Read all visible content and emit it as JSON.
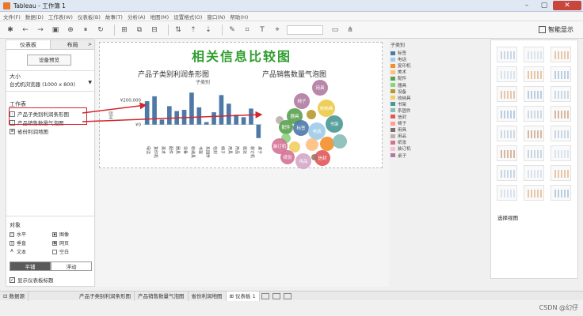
{
  "window": {
    "title": "Tableau - 工作簿 1"
  },
  "menu": [
    "文件(F)",
    "数据(D)",
    "工作表(W)",
    "仪表板(B)",
    "故事(T)",
    "分析(A)",
    "地图(M)",
    "设置格式(O)",
    "窗口(N)",
    "帮助(H)"
  ],
  "toolbar": {
    "show_me": "智能显示"
  },
  "left_panel": {
    "tabs": [
      "仪表板",
      "布局"
    ],
    "preview_button": "设备预览",
    "size_label": "大小",
    "size_value": "台式机浏览器 (1000 x 800)",
    "worksheets_label": "工作表",
    "worksheets": [
      "产品子类别利润条形图",
      "产品销售数量气泡图",
      "省份利润地图"
    ],
    "objects_label": "对象",
    "objects": [
      "水平",
      "图像",
      "垂直",
      "网页",
      "文本",
      "空白"
    ],
    "layout_buttons": [
      "平铺",
      "浮动"
    ],
    "show_title": "显示仪表板标题"
  },
  "dashboard": {
    "title": "相关信息比较图",
    "bar_title": "产品子类别利润条形图",
    "bubble_title": "产品销售数量气泡图",
    "bar_axis_header": "子类别",
    "y_axis_label": "利润",
    "y_ticks": [
      "¥200,000",
      "¥0"
    ],
    "bar_categories": [
      "电话",
      "复印机",
      "美术",
      "配件",
      "器具",
      "设备",
      "收纳具",
      "书架",
      "系固件",
      "信封",
      "椅子",
      "用具",
      "用品",
      "纸张",
      "装订机",
      "桌子"
    ]
  },
  "chart_data": [
    {
      "type": "bar",
      "title": "产品子类别利润条形图",
      "xlabel": "子类别",
      "ylabel": "利润",
      "categories": [
        "电话",
        "复印机",
        "美术",
        "配件",
        "器具",
        "设备",
        "收纳具",
        "书架",
        "系固件",
        "信封",
        "椅子",
        "用具",
        "用品",
        "纸张",
        "装订机",
        "桌子"
      ],
      "values": [
        190000,
        230000,
        40000,
        150000,
        110000,
        120000,
        260000,
        140000,
        20000,
        100000,
        240000,
        170000,
        80000,
        60000,
        130000,
        -110000
      ],
      "ylim": [
        -150000,
        300000
      ]
    },
    {
      "type": "scatter",
      "title": "产品销售数量气泡图",
      "bubbles": [
        {
          "label": "用具",
          "color": "#b07aa1"
        },
        {
          "label": "椅子",
          "color": "#b07aa1"
        },
        {
          "label": "收纳具",
          "color": "#edc948"
        },
        {
          "label": "器具",
          "color": "#59a14f"
        },
        {
          "label": "",
          "color": "#bab0ac"
        },
        {
          "label": "配件",
          "color": "#59a14f"
        },
        {
          "label": "标签",
          "color": "#4e79a7"
        },
        {
          "label": "电话",
          "color": "#a0cbe8"
        },
        {
          "label": "书架",
          "color": "#499894"
        },
        {
          "label": "",
          "color": "#8cd17d"
        },
        {
          "label": "",
          "color": "#f1ce63"
        },
        {
          "label": "装订机",
          "color": "#d37295"
        },
        {
          "label": "",
          "color": "#ffbe7d"
        },
        {
          "label": "",
          "color": "#f28e2b"
        },
        {
          "label": "",
          "color": "#86bcb6"
        },
        {
          "label": "纸张",
          "color": "#d37295"
        },
        {
          "label": "用品",
          "color": "#d4a6c8"
        },
        {
          "label": "信封",
          "color": "#e15759"
        },
        {
          "label": "",
          "color": "#9d7660"
        },
        {
          "label": "",
          "color": "#b6992d"
        }
      ]
    }
  ],
  "legend": {
    "title": "子类别",
    "items": [
      {
        "label": "标签",
        "color": "#4e79a7"
      },
      {
        "label": "电话",
        "color": "#a0cbe8"
      },
      {
        "label": "复印机",
        "color": "#f28e2b"
      },
      {
        "label": "美术",
        "color": "#ffbe7d"
      },
      {
        "label": "配件",
        "color": "#59a14f"
      },
      {
        "label": "器具",
        "color": "#8cd17d"
      },
      {
        "label": "设备",
        "color": "#b6992d"
      },
      {
        "label": "收纳具",
        "color": "#f1ce63"
      },
      {
        "label": "书架",
        "color": "#499894"
      },
      {
        "label": "系固件",
        "color": "#86bcb6"
      },
      {
        "label": "信封",
        "color": "#e15759"
      },
      {
        "label": "椅子",
        "color": "#ff9d9a"
      },
      {
        "label": "用具",
        "color": "#79706e"
      },
      {
        "label": "用品",
        "color": "#bab0ac"
      },
      {
        "label": "纸张",
        "color": "#d37295"
      },
      {
        "label": "装订机",
        "color": "#fabfd2"
      },
      {
        "label": "桌子",
        "color": "#b07aa1"
      }
    ]
  },
  "show_me_panel": {
    "select_view": "选择视图"
  },
  "bottom_tabs": {
    "data_source": "数据源",
    "sheets": [
      "产品子类别利润条形图",
      "产品销售数量气泡图",
      "省份利润地图",
      "仪表板 1"
    ]
  },
  "watermark": "CSDN @幻仔"
}
